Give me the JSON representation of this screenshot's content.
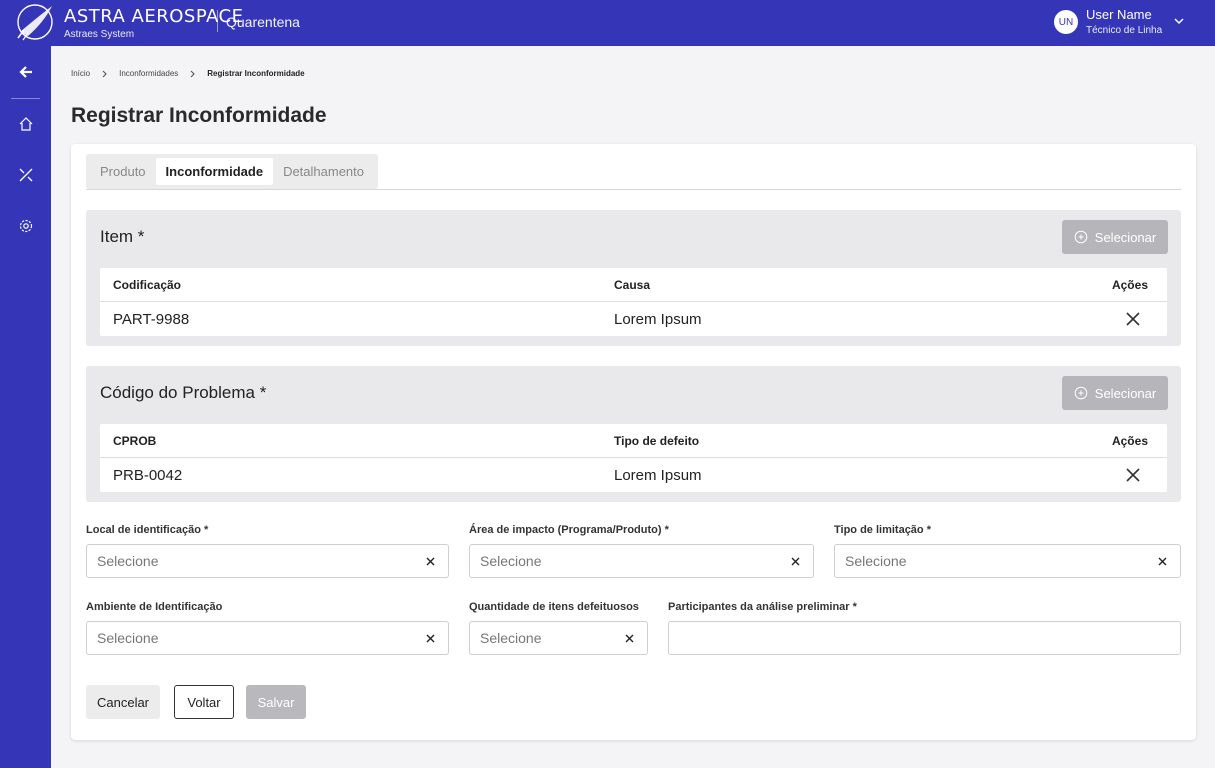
{
  "header": {
    "brand_name": "ASTRA AEROSPACE",
    "brand_sub": "Astraes System",
    "module": "Quarentena",
    "user_initials": "UN",
    "user_name": "User Name",
    "user_role": "Técnico de Linha",
    "bg_color": "#3535b7"
  },
  "sidebar": {
    "items": [
      {
        "icon": "arrow-left-icon"
      },
      {
        "icon": "home-icon"
      },
      {
        "icon": "tools-icon"
      },
      {
        "icon": "gear-icon"
      }
    ]
  },
  "breadcrumb": [
    "Início",
    "Inconformidades",
    "Registrar Inconformidade"
  ],
  "page_title": "Registrar Inconformidade",
  "tabs": [
    {
      "label": "Produto",
      "active": false
    },
    {
      "label": "Inconformidade",
      "active": true
    },
    {
      "label": "Detalhamento",
      "active": false
    }
  ],
  "item_section": {
    "title": "Item *",
    "select_label": "Selecionar",
    "columns": [
      "Codificação",
      "Causa",
      "Ações"
    ],
    "rows": [
      [
        "PART-9988",
        "Lorem Ipsum"
      ]
    ]
  },
  "problem_section": {
    "title": "Código do Problema *",
    "select_label": "Selecionar",
    "columns": [
      "CPROB",
      "Tipo de defeito",
      "Ações"
    ],
    "rows": [
      [
        "PRB-0042",
        "Lorem Ipsum"
      ]
    ]
  },
  "fields": {
    "local": {
      "label": "Local de identificação *",
      "placeholder": "Selecione"
    },
    "area": {
      "label": "Área de impacto (Programa/Produto) *",
      "placeholder": "Selecione"
    },
    "tipo": {
      "label": "Tipo de limitação *",
      "placeholder": "Selecione"
    },
    "ambiente": {
      "label": "Ambiente de Identificação",
      "placeholder": "Selecione"
    },
    "quantidade": {
      "label": "Quantidade de itens defeituosos",
      "placeholder": "Selecione"
    },
    "participantes": {
      "label": "Participantes da análise preliminar *",
      "value": ""
    }
  },
  "actions": {
    "cancel": "Cancelar",
    "back": "Voltar",
    "save": "Salvar"
  }
}
